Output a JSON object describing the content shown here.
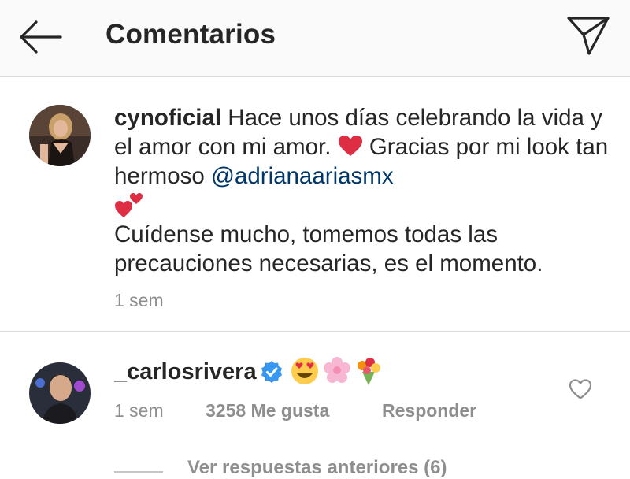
{
  "header": {
    "title": "Comentarios",
    "back_icon": "arrow-left-icon",
    "send_icon": "paper-plane-icon"
  },
  "post": {
    "username": "cynoficial",
    "caption_part1": " Hace unos días celebrando la vida y el amor con mi amor. ",
    "caption_part2": " Gracias por mi look tan hermoso ",
    "mention": "@adrianaariasmx",
    "caption_part3": "Cuídense mucho, tomemos todas las precauciones necesarias, es el momento.",
    "time": "1 sem",
    "emojis": [
      "red-heart-icon",
      "two-hearts-icon"
    ]
  },
  "comment": {
    "username": "_carlosrivera",
    "verified": true,
    "emojis": [
      "heart-eyes-face-icon",
      "cherry-blossom-icon",
      "bouquet-icon"
    ],
    "time": "1 sem",
    "likes": "3258 Me gusta",
    "reply": "Responder",
    "view_replies": "Ver respuestas anteriores (6)"
  },
  "colors": {
    "text": "#262626",
    "muted": "#8e8e8e",
    "mention": "#00376b",
    "verified": "#3897f0",
    "header_bg": "#fafafa",
    "divider": "#dbdbdb"
  }
}
